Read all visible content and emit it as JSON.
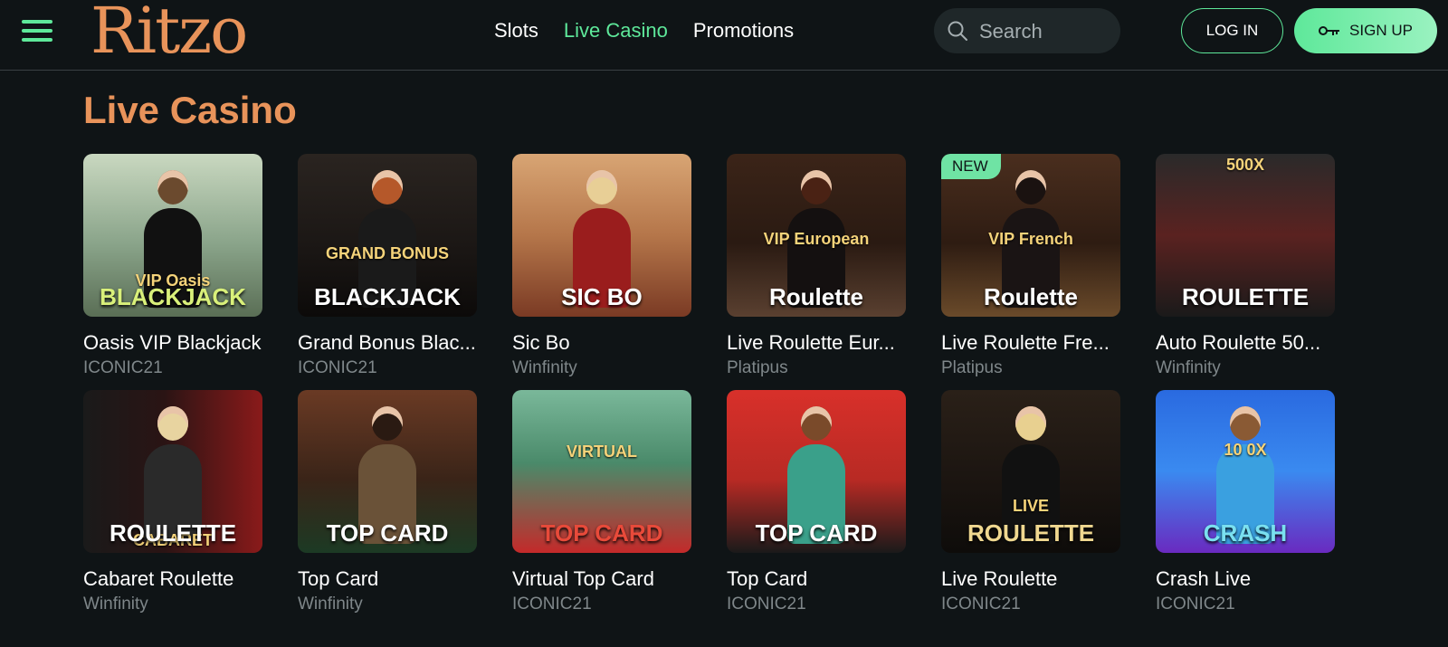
{
  "header": {
    "logo": "Ritzo",
    "nav": [
      {
        "label": "Slots",
        "active": false
      },
      {
        "label": "Live Casino",
        "active": true
      },
      {
        "label": "Promotions",
        "active": false
      }
    ],
    "search_placeholder": "Search",
    "login_label": "LOG IN",
    "signup_label": "SIGN UP"
  },
  "page_title": "Live Casino",
  "colors": {
    "accent": "#5ee89a",
    "brand": "#e8935a",
    "background": "#0f1416"
  },
  "games": [
    {
      "title": "Oasis VIP Blackjack",
      "provider": "ICONIC21",
      "art_text": "BLACKJACK",
      "art_sub": "VIP Oasis",
      "badge": ""
    },
    {
      "title": "Grand Bonus Blac...",
      "provider": "ICONIC21",
      "art_text": "BLACKJACK",
      "art_sub": "GRAND BONUS",
      "badge": ""
    },
    {
      "title": "Sic Bo",
      "provider": "Winfinity",
      "art_text": "SIC BO",
      "art_sub": "",
      "badge": ""
    },
    {
      "title": "Live Roulette Eur...",
      "provider": "Platipus",
      "art_text": "Roulette",
      "art_sub": "VIP European",
      "badge": ""
    },
    {
      "title": "Live Roulette Fre...",
      "provider": "Platipus",
      "art_text": "Roulette",
      "art_sub": "VIP French",
      "badge": "NEW"
    },
    {
      "title": "Auto Roulette 50...",
      "provider": "Winfinity",
      "art_text": "ROULETTE",
      "art_sub": "500X",
      "badge": ""
    },
    {
      "title": "Cabaret Roulette",
      "provider": "Winfinity",
      "art_text": "ROULETTE",
      "art_sub": "CABARET",
      "badge": ""
    },
    {
      "title": "Top Card",
      "provider": "Winfinity",
      "art_text": "TOP CARD",
      "art_sub": "",
      "badge": ""
    },
    {
      "title": "Virtual Top Card",
      "provider": "ICONIC21",
      "art_text": "TOP CARD",
      "art_sub": "VIRTUAL",
      "badge": ""
    },
    {
      "title": "Top Card",
      "provider": "ICONIC21",
      "art_text": "TOP CARD",
      "art_sub": "",
      "badge": ""
    },
    {
      "title": "Live Roulette",
      "provider": "ICONIC21",
      "art_text": "ROULETTE",
      "art_sub": "LIVE",
      "badge": ""
    },
    {
      "title": "Crash Live",
      "provider": "ICONIC21",
      "art_text": "CRASH",
      "art_sub": "10 0X",
      "badge": ""
    }
  ]
}
